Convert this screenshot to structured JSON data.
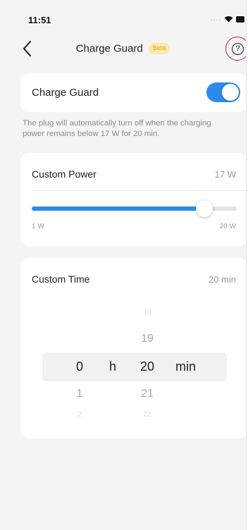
{
  "status_bar": {
    "time": "11:51",
    "signal_dots": "....",
    "icons": [
      "wifi-icon",
      "battery-icon"
    ]
  },
  "nav": {
    "title": "Charge Guard",
    "badge": "Beta",
    "back_icon": "chevron-left-icon",
    "help_icon": "question-circle-icon",
    "help_glyph": "?"
  },
  "charge_guard": {
    "label": "Charge Guard",
    "enabled": true,
    "description": "The plug will automatically turn off when the charging power remains below 17 W for 20 min."
  },
  "custom_power": {
    "label": "Custom Power",
    "value": "17 W",
    "slider": {
      "min_label": "1 W",
      "max_label": "20 W",
      "min": 1,
      "max": 20,
      "value": 17
    }
  },
  "custom_time": {
    "label": "Custom Time",
    "value": "20 min",
    "picker": {
      "hours": {
        "selected": "0",
        "below": [
          "1",
          "2"
        ]
      },
      "hour_unit": "h",
      "minutes": {
        "above": [
          "18",
          "19"
        ],
        "selected": "20",
        "below": [
          "21",
          "22"
        ]
      },
      "minute_unit": "min"
    }
  },
  "colors": {
    "accent": "#2c8ae8",
    "beta_bg": "#fbe9a6",
    "beta_text": "#e3a21b",
    "background": "#f4f4f6",
    "highlight_ring": "#c1202f"
  }
}
